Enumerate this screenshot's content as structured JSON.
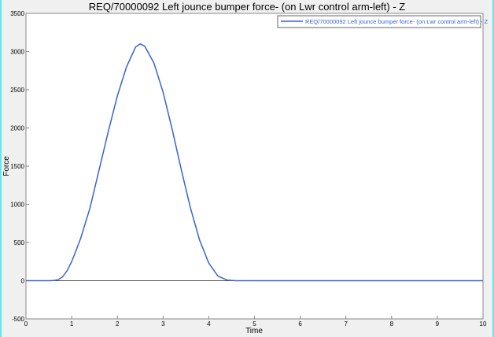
{
  "chart_data": {
    "type": "line",
    "title": "REQ/70000092 Left jounce bumper force- (on Lwr control arm-left) - Z",
    "xlabel": "Time",
    "ylabel": "Force",
    "xlim": [
      0,
      10
    ],
    "ylim": [
      -500,
      3500
    ],
    "xticks": [
      "0",
      "1",
      "2",
      "3",
      "4",
      "5",
      "6",
      "7",
      "8",
      "9",
      "10"
    ],
    "yticks": [
      "3500",
      "3000",
      "2500",
      "2000",
      "1500",
      "1000",
      "500",
      "0",
      "-500"
    ],
    "grid": false,
    "legend_position": "top-right",
    "series": [
      {
        "name": "REQ/70000092 Left jounce bumper force- (on Lwr control arm-left) - Z",
        "color": "#3a63d0",
        "x": [
          0,
          0.5,
          0.6,
          0.7,
          0.8,
          0.9,
          1.0,
          1.1,
          1.2,
          1.4,
          1.6,
          1.8,
          2.0,
          2.2,
          2.4,
          2.5,
          2.6,
          2.8,
          3.0,
          3.2,
          3.4,
          3.6,
          3.8,
          4.0,
          4.2,
          4.4,
          4.6,
          10
        ],
        "y": [
          0,
          0,
          2,
          12,
          50,
          130,
          250,
          400,
          560,
          950,
          1450,
          1950,
          2420,
          2800,
          3060,
          3100,
          3070,
          2850,
          2470,
          1980,
          1450,
          950,
          530,
          230,
          60,
          8,
          0,
          0
        ]
      }
    ]
  }
}
